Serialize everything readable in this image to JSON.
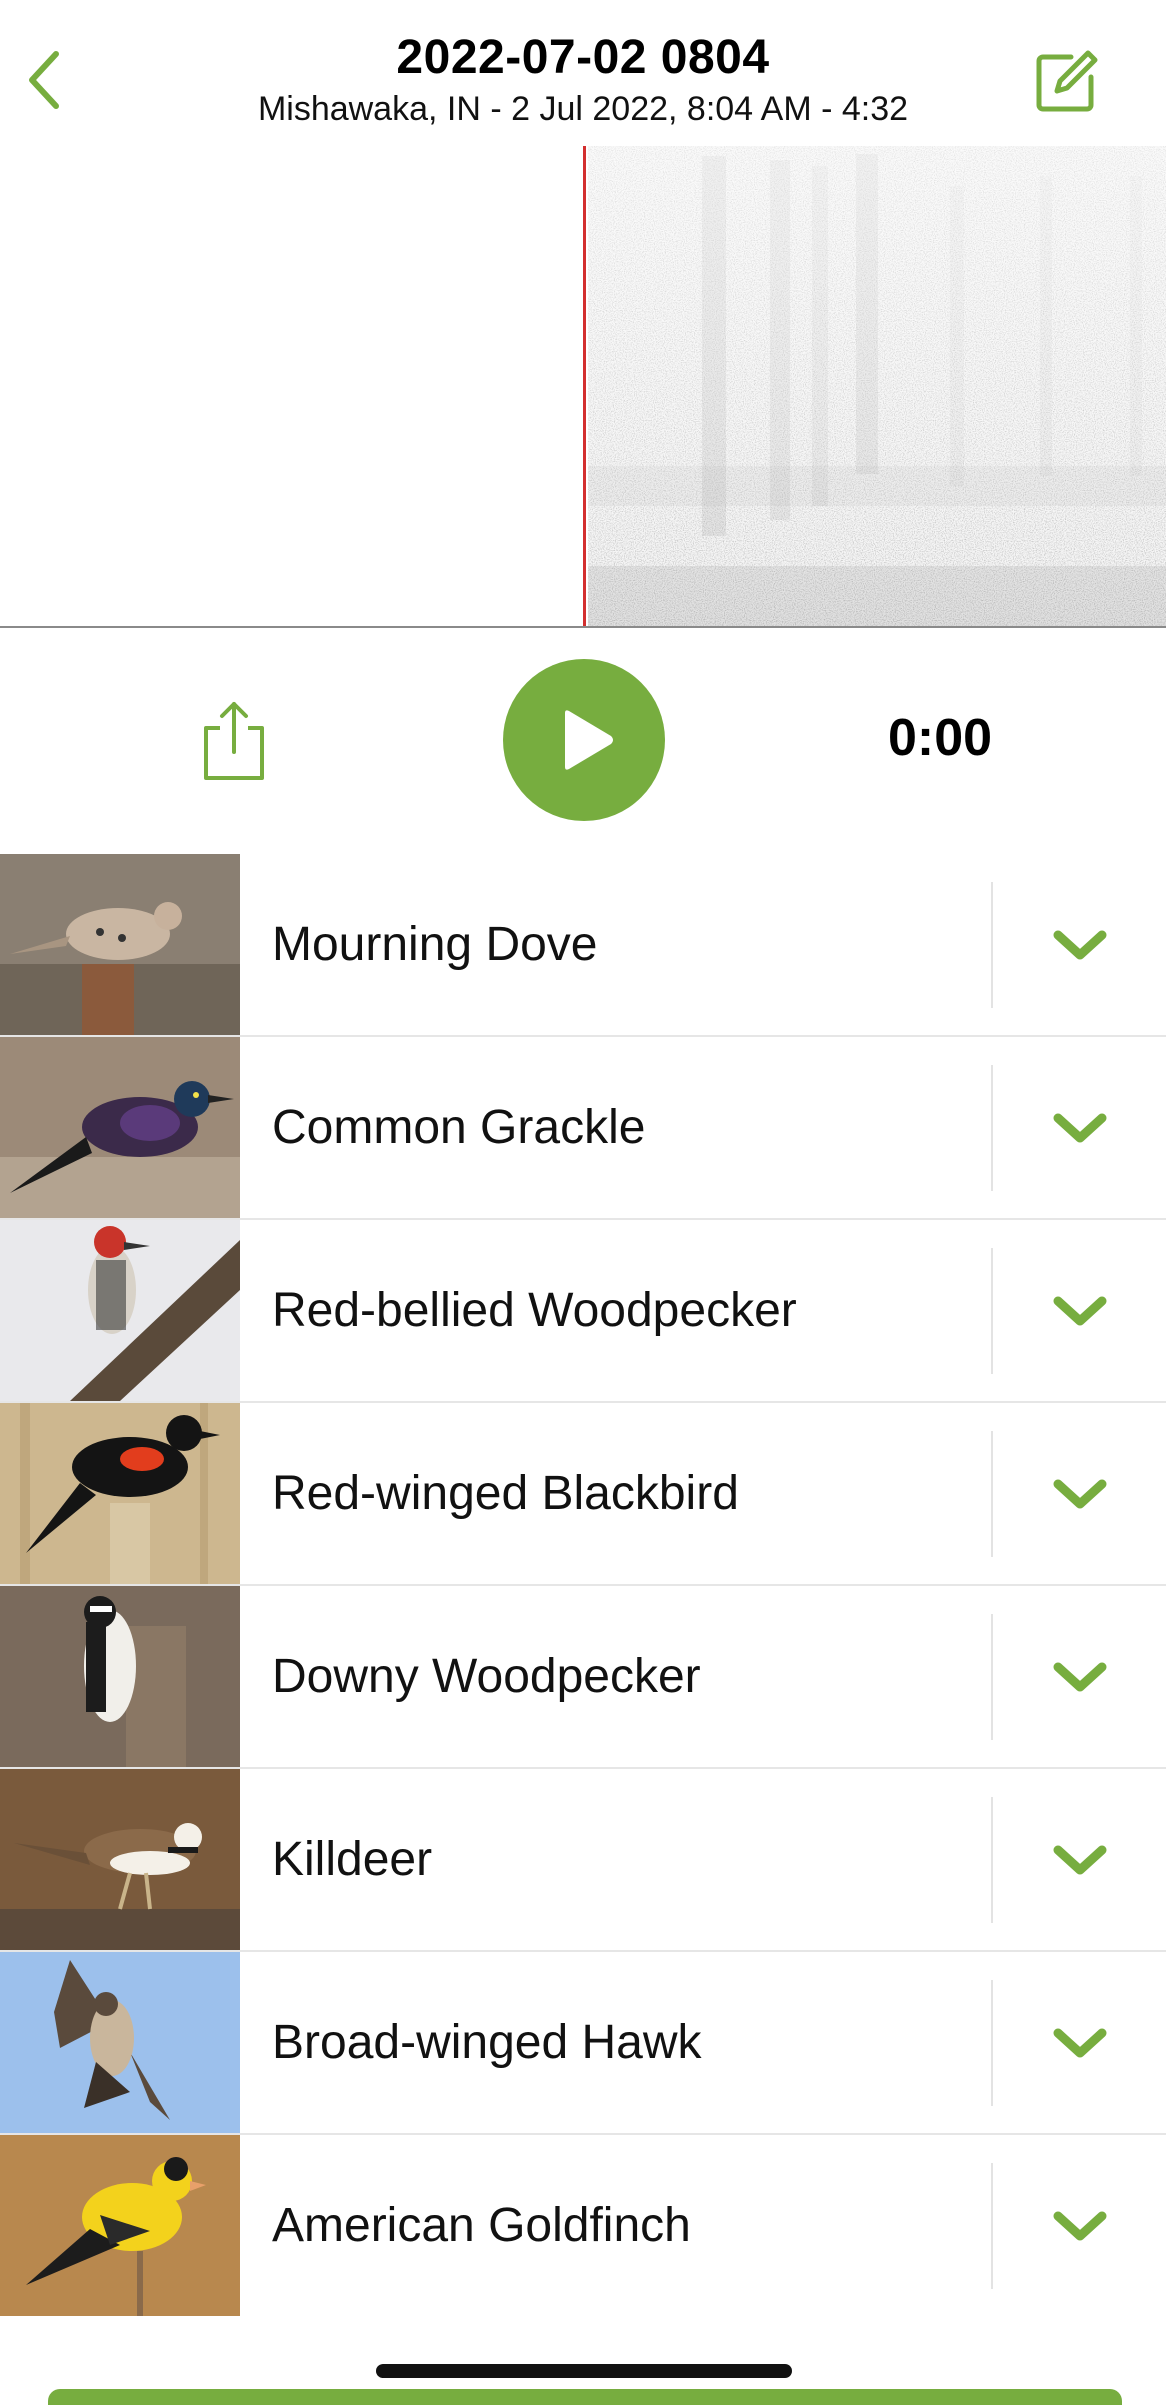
{
  "header": {
    "title": "2022-07-02 0804",
    "subtitle": "Mishawaka, IN - 2 Jul 2022, 8:04 AM - 4:32",
    "back_icon": "chevron-left-icon",
    "edit_icon": "edit-square-icon"
  },
  "player": {
    "time": "0:00",
    "play_icon": "play-icon",
    "share_icon": "share-icon"
  },
  "species": [
    {
      "name": "Mourning Dove",
      "expand_icon": "chevron-down-icon"
    },
    {
      "name": "Common Grackle",
      "expand_icon": "chevron-down-icon"
    },
    {
      "name": "Red-bellied Woodpecker",
      "expand_icon": "chevron-down-icon"
    },
    {
      "name": "Red-winged Blackbird",
      "expand_icon": "chevron-down-icon"
    },
    {
      "name": "Downy Woodpecker",
      "expand_icon": "chevron-down-icon"
    },
    {
      "name": "Killdeer",
      "expand_icon": "chevron-down-icon"
    },
    {
      "name": "Broad-winged Hawk",
      "expand_icon": "chevron-down-icon"
    },
    {
      "name": "American Goldfinch",
      "expand_icon": "chevron-down-icon"
    }
  ],
  "colors": {
    "accent": "#77ad3f",
    "playhead": "#d32f2f",
    "divider": "#e6e6e6"
  }
}
